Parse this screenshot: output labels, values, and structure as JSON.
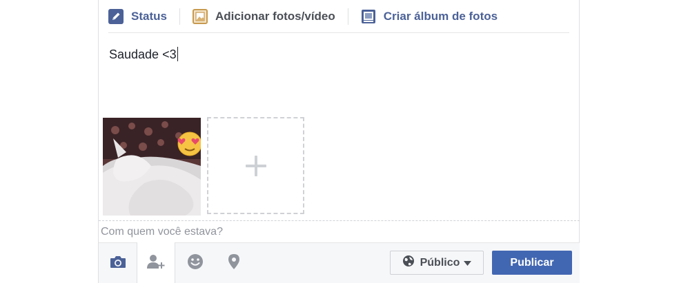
{
  "tabs": {
    "status": {
      "label": "Status",
      "icon": "pencil-icon"
    },
    "add_photos": {
      "label": "Adicionar fotos/vídeo",
      "icon": "photo-icon"
    },
    "create_album": {
      "label": "Criar álbum de fotos",
      "icon": "album-icon"
    }
  },
  "composer": {
    "text": "Saudade <3"
  },
  "photos": {
    "items": [
      {
        "alt": "white cat sleeping with heart-eyes emoji sticker"
      }
    ],
    "add_icon": "plus-icon"
  },
  "with_who": {
    "placeholder": "Com quem você estava?"
  },
  "footer": {
    "icons": [
      "camera-icon",
      "tag-friend-icon",
      "emoji-icon",
      "location-pin-icon"
    ],
    "audience_label": "Público",
    "publish_label": "Publicar"
  },
  "colors": {
    "brand_blue": "#4267b2",
    "tab_blue": "#4b6197",
    "icon_gray": "#90949c"
  }
}
